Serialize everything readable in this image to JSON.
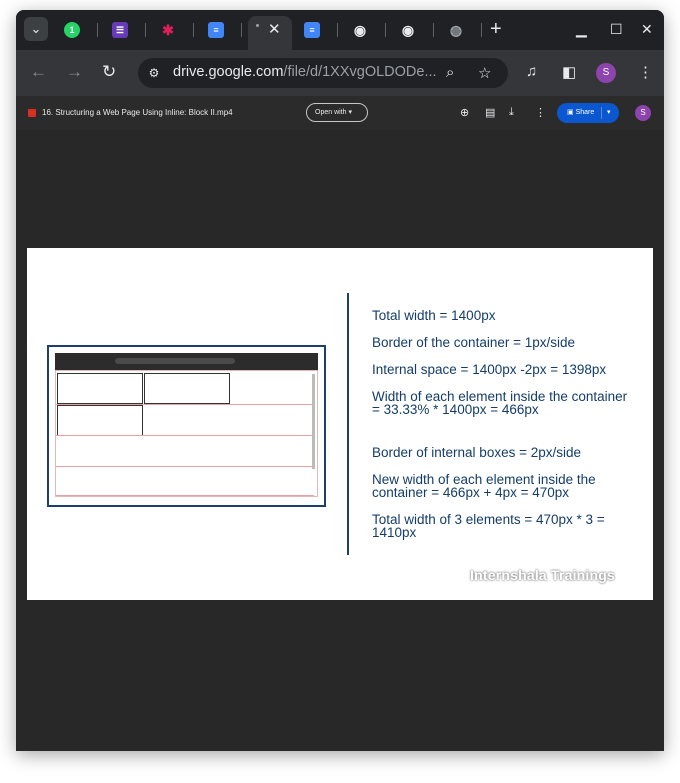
{
  "browser": {
    "tabs": [
      {
        "name": "whatsapp",
        "icon": "whatsapp-icon",
        "badge": "1",
        "color": "#25d366"
      },
      {
        "name": "forms",
        "icon": "forms-icon",
        "color": "#673ab7"
      },
      {
        "name": "slack",
        "icon": "slack-icon",
        "color": "#e01e5a"
      },
      {
        "name": "docs-1",
        "icon": "docs-icon",
        "color": "#4285f4"
      },
      {
        "name": "drive-video",
        "icon": "drive-icon",
        "active": true
      },
      {
        "name": "docs-2",
        "icon": "docs-icon",
        "color": "#4285f4"
      },
      {
        "name": "chrome-1",
        "icon": "chrome-icon"
      },
      {
        "name": "chrome-2",
        "icon": "chrome-icon"
      },
      {
        "name": "globe",
        "icon": "globe-icon"
      }
    ],
    "url_domain": "drive.google.com",
    "url_path": "/file/d/1XXvgOLDODe...",
    "profile_initial": "S"
  },
  "drive": {
    "file_name": "16. Structuring a Web Page Using Inline: Block II.mp4",
    "open_with_label": "Open with",
    "share_label": "Share",
    "avatar_initial": "S"
  },
  "slide": {
    "lines": [
      "Total width = 1400px",
      "Border of the container = 1px/side",
      "Internal space = 1400px -2px = 1398px",
      "Width of each element inside the container = 33.33% * 1400px = 466px",
      "Border of internal boxes = 2px/side",
      "New width of each element inside the container = 466px + 4px = 470px",
      "Total width of 3 elements = 470px * 3 = 1410px"
    ],
    "watermark": "Internshala Trainings"
  },
  "colors": {
    "slide_text": "#143d6b",
    "share_button": "#0b57d0",
    "avatar": "#8e44ad"
  }
}
